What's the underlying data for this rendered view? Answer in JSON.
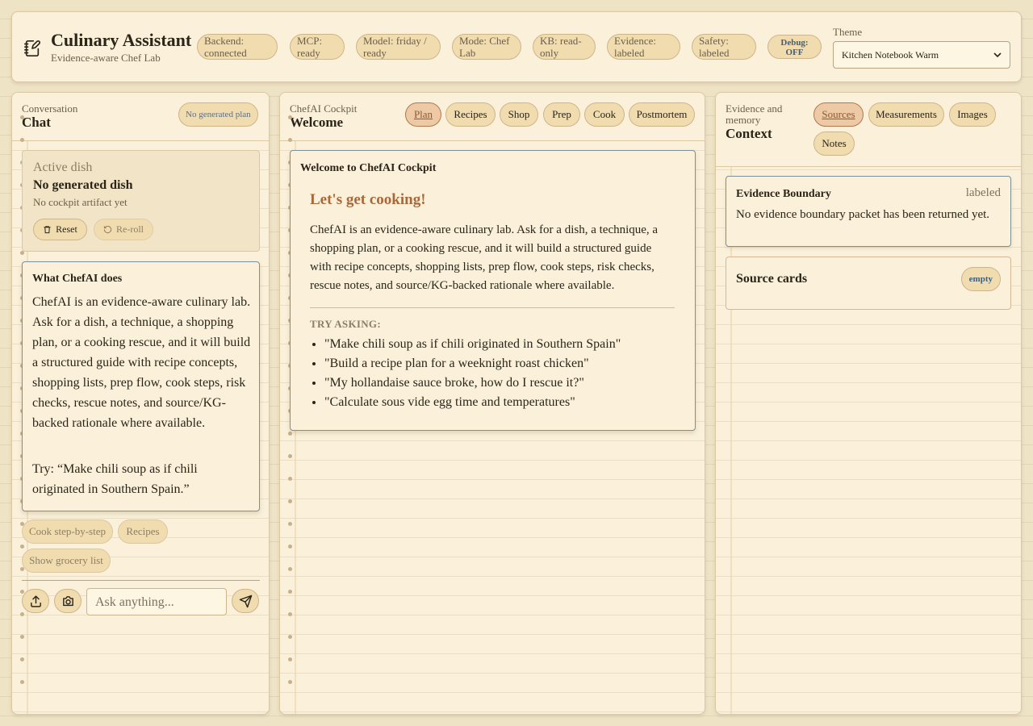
{
  "brand": {
    "title": "Culinary Assistant",
    "subtitle": "Evidence-aware Chef Lab",
    "icon": "notebook-pen-icon"
  },
  "status": [
    {
      "label": "Backend: connected"
    },
    {
      "label": "MCP: ready"
    },
    {
      "label": "Model: friday / ready"
    },
    {
      "label": "Mode: Chef Lab"
    },
    {
      "label": "KB: read-only"
    },
    {
      "label": "Evidence: labeled"
    },
    {
      "label": "Safety: labeled"
    }
  ],
  "debug": {
    "label": "Debug: OFF"
  },
  "theme": {
    "label": "Theme",
    "selected": "Kitchen Notebook Warm"
  },
  "colors": {
    "accent": "#8a5a33",
    "paper": "#fbf1da",
    "pill": "#f1dcb0",
    "debug_text": "#3f5f7a"
  },
  "chat": {
    "kicker": "Conversation",
    "title": "Chat",
    "badge": "No generated plan",
    "active_dish": {
      "label": "Active dish",
      "name": "No generated dish",
      "note": "No cockpit artifact yet",
      "reset": "Reset",
      "reroll": "Re-roll"
    },
    "what": {
      "title": "What ChefAI does",
      "body": "ChefAI is an evidence-aware culinary lab. Ask for a dish, a technique, a shopping plan, or a cooking rescue, and it will build a structured guide with recipe concepts, shopping lists, prep flow, cook steps, risk checks, rescue notes, and source/KG-backed rationale where available.",
      "try": "Try: “Make chili soup as if chili originated in Southern Spain.”"
    },
    "chips": [
      "Cook step-by-step",
      "Recipes",
      "Show grocery list"
    ],
    "input_placeholder": "Ask anything..."
  },
  "cockpit": {
    "kicker": "ChefAI Cockpit",
    "title": "Welcome",
    "tabs": [
      "Plan",
      "Recipes",
      "Shop",
      "Prep",
      "Cook",
      "Postmortem"
    ],
    "active_tab": "Plan",
    "welcome": {
      "header": "Welcome to ChefAI Cockpit",
      "heading": "Let's get cooking!",
      "body": "ChefAI is an evidence-aware culinary lab. Ask for a dish, a technique, a shopping plan, or a cooking rescue, and it will build a structured guide with recipe concepts, shopping lists, prep flow, cook steps, risk checks, rescue notes, and source/KG-backed rationale where available.",
      "try_label": "TRY ASKING:",
      "examples": [
        "\"Make chili soup as if chili originated in Southern Spain\"",
        "\"Build a recipe plan for a weeknight roast chicken\"",
        "\"My hollandaise sauce broke, how do I rescue it?\"",
        "\"Calculate sous vide egg time and temperatures\""
      ]
    }
  },
  "context": {
    "kicker": "Evidence and memory",
    "title": "Context",
    "tabs": [
      "Sources",
      "Measurements",
      "Images",
      "Notes"
    ],
    "active_tab": "Sources",
    "boundary": {
      "title": "Evidence Boundary",
      "status": "labeled",
      "text": "No evidence boundary packet has been returned yet."
    },
    "source_cards": {
      "title": "Source cards",
      "badge": "empty"
    }
  }
}
